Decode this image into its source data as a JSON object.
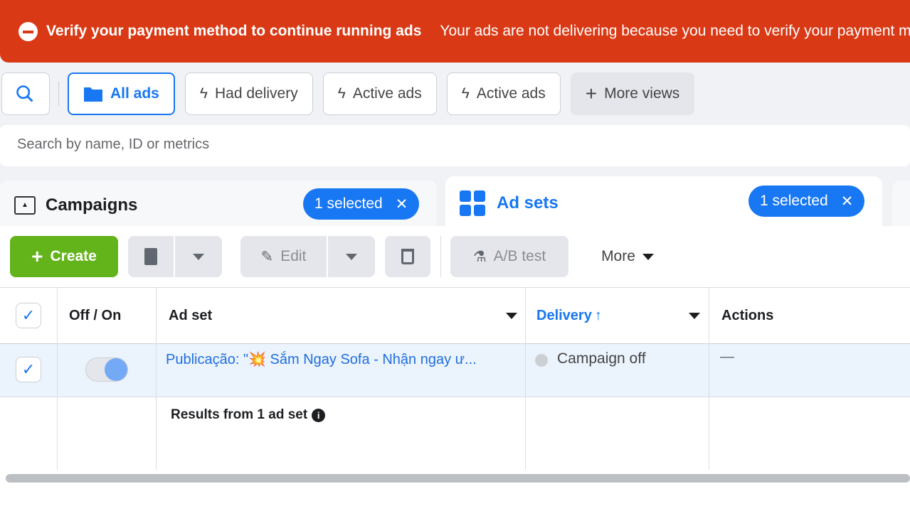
{
  "banner": {
    "title": "Verify your payment method to continue running ads",
    "message": "Your ads are not delivering because you need to verify your payment method",
    "icon": "minus-circle-icon",
    "color": "#d93915"
  },
  "views": [
    {
      "label": "All ads",
      "icon": "folder-icon",
      "selected": true
    },
    {
      "label": "Had delivery",
      "icon": "lightning-icon"
    },
    {
      "label": "Active ads",
      "icon": "lightning-icon"
    },
    {
      "label": "Active ads",
      "icon": "lightning-icon"
    },
    {
      "label": "More views",
      "icon": "plus-icon"
    }
  ],
  "search": {
    "placeholder": "Search by name, ID or metrics"
  },
  "tabs": {
    "campaigns": {
      "label": "Campaigns",
      "selected": "1 selected"
    },
    "adsets": {
      "label": "Ad sets",
      "selected": "1 selected"
    }
  },
  "toolbar": {
    "create": "Create",
    "edit": "Edit",
    "ab_test": "A/B test",
    "more": "More"
  },
  "table": {
    "headers": {
      "offon": "Off / On",
      "adset": "Ad set",
      "delivery": "Delivery",
      "actions": "Actions"
    },
    "row": {
      "name": "Publicação: \"💥 Sắm Ngay Sofa - Nhận ngay ư...",
      "delivery": "Campaign off",
      "actions": "—",
      "checked": true,
      "toggle_on": true
    },
    "footer": "Results from 1 ad set"
  },
  "accent": "#1877f2"
}
